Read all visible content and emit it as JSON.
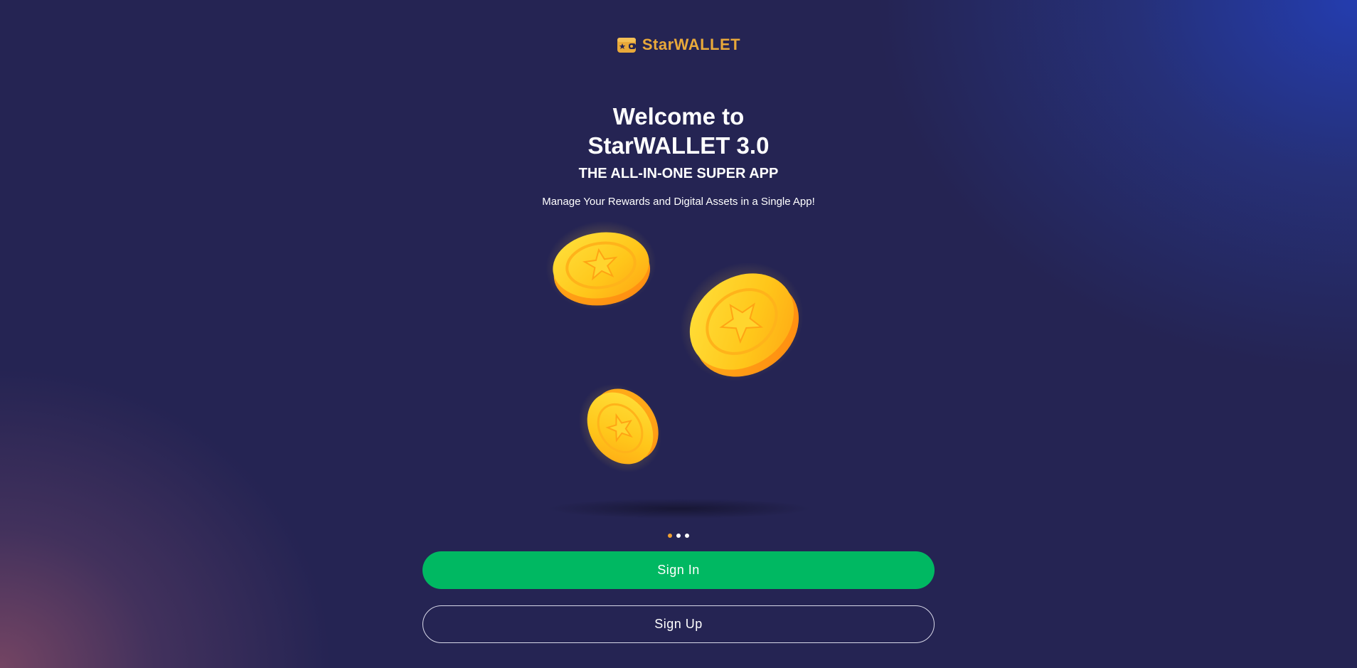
{
  "brand": {
    "name": "StarWALLET",
    "logo_icon": "wallet-star-icon",
    "accent_color": "#e9a93a"
  },
  "hero": {
    "title_line1": "Welcome to",
    "title_line2": "StarWALLET 3.0",
    "subtitle": "THE ALL-IN-ONE SUPER APP",
    "tagline": "Manage Your Rewards and Digital Assets in a Single App!"
  },
  "illustration": {
    "icon": "gold-star-coins-illustration"
  },
  "carousel": {
    "slide_count": 3,
    "active_index": 0
  },
  "actions": {
    "sign_in": "Sign In",
    "sign_up": "Sign Up",
    "sign_in_color": "#00b862"
  },
  "colors": {
    "background": "#252453",
    "coin_gold": "#ffc61a",
    "coin_orange": "#ff9a10"
  }
}
